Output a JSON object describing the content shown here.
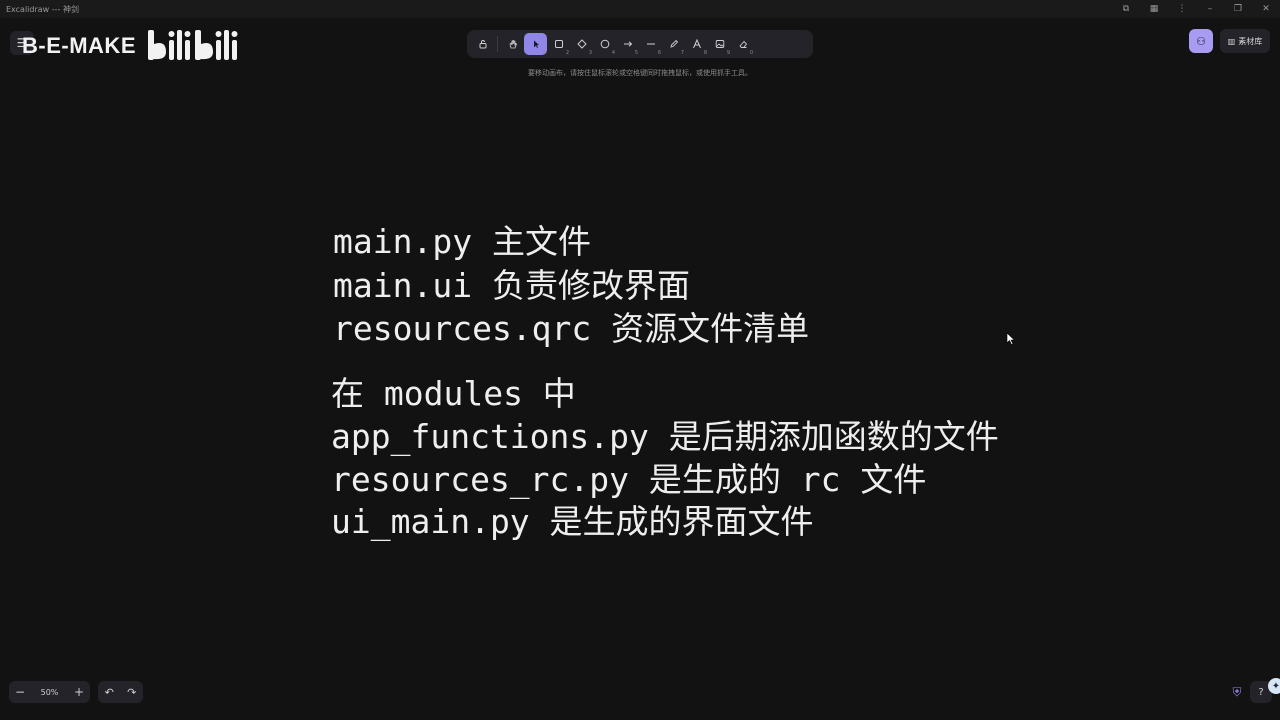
{
  "window": {
    "title": "Excalidraw --- 神剑"
  },
  "watermark": {
    "text": "B-E-MAKE",
    "logo": "bilibili"
  },
  "toolbar": {
    "tools": [
      {
        "name": "lock",
        "key": ""
      },
      {
        "name": "hand",
        "key": ""
      },
      {
        "name": "selection",
        "key": "1",
        "active": true
      },
      {
        "name": "rectangle",
        "key": "2"
      },
      {
        "name": "diamond",
        "key": "3"
      },
      {
        "name": "ellipse",
        "key": "4"
      },
      {
        "name": "arrow",
        "key": "5"
      },
      {
        "name": "line",
        "key": "6"
      },
      {
        "name": "pencil",
        "key": "7"
      },
      {
        "name": "text",
        "key": "8"
      },
      {
        "name": "image",
        "key": "9"
      },
      {
        "name": "eraser",
        "key": "0"
      }
    ]
  },
  "hint": "要移动画布，请按住鼠标滚轮或空格键同时拖拽鼠标，或使用抓手工具。",
  "library": {
    "label": "素材库"
  },
  "canvas": {
    "lines": [
      "main.py 主文件",
      "main.ui 负责修改界面",
      "resources.qrc 资源文件清单",
      "在 modules 中",
      "app_functions.py 是后期添加函数的文件",
      "resources_rc.py 是生成的 rc 文件",
      "ui_main.py 是生成的界面文件"
    ]
  },
  "footer": {
    "zoom": "50%",
    "zoom_out": "−",
    "zoom_in": "+",
    "undo": "↶",
    "redo": "↷"
  },
  "colors": {
    "background": "#121212",
    "accent": "#8f86e8",
    "panel": "#232329"
  }
}
